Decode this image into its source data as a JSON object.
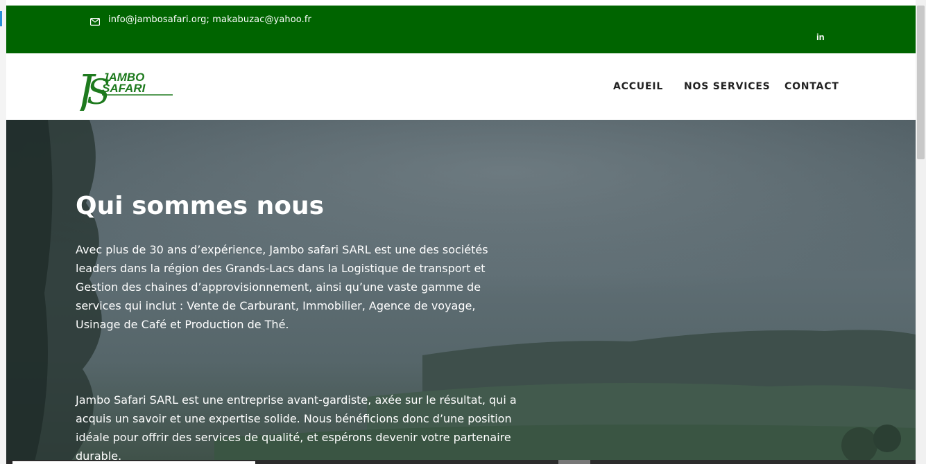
{
  "topbar": {
    "emails": "info@jambosafari.org; makabuzac@yahoo.fr",
    "mail_icon": "mail-icon",
    "linkedin_label": "in",
    "color": "#006400"
  },
  "header": {
    "logo": {
      "line1": "JAMBO",
      "line2": "SAFARI",
      "color": "#1e7a1e"
    },
    "nav": [
      {
        "label": "ACCUEIL"
      },
      {
        "label": "NOS SERVICES"
      },
      {
        "label": "CONTACT"
      }
    ]
  },
  "hero": {
    "title": "Qui sommes nous",
    "paragraphs": [
      "Avec plus de 30 ans d’expérience, Jambo safari SARL est une des sociétés leaders dans la région des Grands-Lacs dans la Logistique de transport et Gestion des chaines d’approvisionnement, ainsi qu’une vaste gamme de services qui inclut : Vente de Carburant, Immobilier, Agence de voyage, Usinage de Café et Production de Thé.",
      "Jambo Safari SARL est une entreprise avant-gardiste, axée sur le résultat, qui a acquis un savoir et une expertise solide. Nous bénéficions donc d’une position idéale pour offrir des services de qualité, et espérons devenir votre partenaire durable."
    ]
  }
}
